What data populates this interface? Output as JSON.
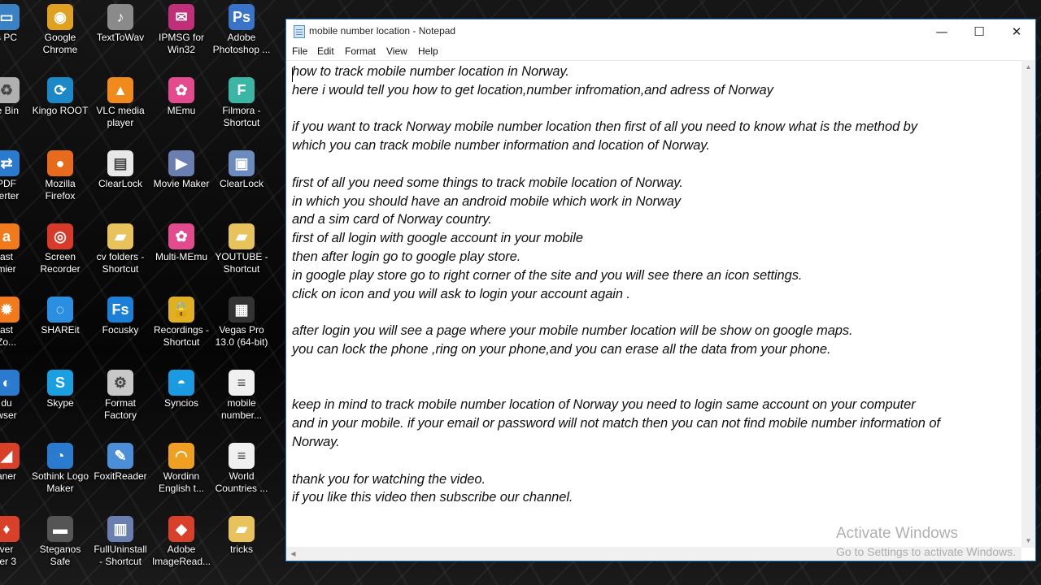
{
  "desktop": {
    "icons": [
      {
        "label": "s PC",
        "icon": "computer-icon",
        "color": "#3b82c4"
      },
      {
        "label": "Google\nChrome",
        "icon": "chrome-icon",
        "color": "#e0a020"
      },
      {
        "label": "TextToWav",
        "icon": "speaker-icon",
        "color": "#8a8a8a"
      },
      {
        "label": "IPMSG for\nWin32",
        "icon": "ipmsg-icon",
        "color": "#c0307a"
      },
      {
        "label": "Adobe\nPhotoshop ...",
        "icon": "photoshop-icon",
        "color": "#3a74c8"
      },
      {
        "label": "le Bin",
        "icon": "recycle-bin-icon",
        "color": "#b0b0b0"
      },
      {
        "label": "Kingo ROOT",
        "icon": "kingo-root-icon",
        "color": "#1b88c8"
      },
      {
        "label": "VLC media\nplayer",
        "icon": "vlc-icon",
        "color": "#f08a1c"
      },
      {
        "label": "MEmu",
        "icon": "memu-icon",
        "color": "#e44b8e"
      },
      {
        "label": "Filmora -\nShortcut",
        "icon": "filmora-icon",
        "color": "#3bb5a4"
      },
      {
        "label": "PDF\nverter",
        "icon": "pdf-converter-icon",
        "color": "#2a7bd0"
      },
      {
        "label": "Mozilla\nFirefox",
        "icon": "firefox-icon",
        "color": "#e86a1c"
      },
      {
        "label": "ClearLock",
        "icon": "clearlock-doc-icon",
        "color": "#e8e8e8"
      },
      {
        "label": "Movie Maker",
        "icon": "movie-maker-icon",
        "color": "#6a7fb0"
      },
      {
        "label": "ClearLock",
        "icon": "clearlock-monitor-icon",
        "color": "#6c8cc0"
      },
      {
        "label": "ast\nmier",
        "icon": "avast-icon",
        "color": "#f07a1c"
      },
      {
        "label": "Screen\nRecorder",
        "icon": "screen-recorder-icon",
        "color": "#d83a2a"
      },
      {
        "label": "cv folders -\nShortcut",
        "icon": "folder-icon",
        "color": "#e8c25a"
      },
      {
        "label": "Multi-MEmu",
        "icon": "multi-memu-icon",
        "color": "#e44b8e"
      },
      {
        "label": "YOUTUBE -\nShortcut",
        "icon": "folder-icon",
        "color": "#e8c25a"
      },
      {
        "label": "ast\nZo...",
        "icon": "gear-icon",
        "color": "#f07a1c"
      },
      {
        "label": "SHAREit",
        "icon": "shareit-icon",
        "color": "#2a8fe0"
      },
      {
        "label": "Focusky",
        "icon": "focusky-icon",
        "color": "#1b7fd8"
      },
      {
        "label": "Recordings -\nShortcut",
        "icon": "lock-icon",
        "color": "#e0b020"
      },
      {
        "label": "Vegas Pro\n13.0 (64-bit)",
        "icon": "vegas-icon",
        "color": "#333"
      },
      {
        "label": "du\nwser",
        "icon": "baidu-browser-icon",
        "color": "#2a7bd0"
      },
      {
        "label": "Skype",
        "icon": "skype-icon",
        "color": "#1aa0e0"
      },
      {
        "label": "Format\nFactory",
        "icon": "format-factory-icon",
        "color": "#c8c8c8"
      },
      {
        "label": "Syncios",
        "icon": "syncios-icon",
        "color": "#1a9ae0"
      },
      {
        "label": "mobile\nnumber...",
        "icon": "text-file-icon",
        "color": "#f0f0f0"
      },
      {
        "label": "aner",
        "icon": "scanner-icon",
        "color": "#d8402a"
      },
      {
        "label": "Sothink Logo\nMaker",
        "icon": "sothink-icon",
        "color": "#2a7bd0"
      },
      {
        "label": "FoxitReader",
        "icon": "foxit-icon",
        "color": "#4a8fd8"
      },
      {
        "label": "Wordinn\nEnglish t...",
        "icon": "wordinn-icon",
        "color": "#f0a020"
      },
      {
        "label": "World\nCountries ...",
        "icon": "text-file-icon",
        "color": "#f0f0f0"
      },
      {
        "label": "ver\nter 3",
        "icon": "driver-icon",
        "color": "#d8402a"
      },
      {
        "label": "Steganos\nSafe",
        "icon": "steganos-icon",
        "color": "#555"
      },
      {
        "label": "FullUninstall\n- Shortcut",
        "icon": "uninstall-icon",
        "color": "#6a7fb0"
      },
      {
        "label": "Adobe\nImageRead...",
        "icon": "imageready-icon",
        "color": "#d8402a"
      },
      {
        "label": "tricks",
        "icon": "folder-icon",
        "color": "#e8c25a"
      }
    ]
  },
  "notepad": {
    "title": "mobile number location - Notepad",
    "menu": [
      "File",
      "Edit",
      "Format",
      "View",
      "Help"
    ],
    "lines": [
      "how to track mobile number location in Norway.",
      "here i would tell you how to get location,number infromation,and adress of Norway",
      "",
      "if you want to track Norway mobile number location then first of all you need to know what is the method by",
      "which you can track mobile number information and location of Norway.",
      "",
      "first of all you need some things to track mobile location of Norway.",
      "in which you should have an android mobile which work in Norway",
      "and a sim card of Norway country.",
      "first of all login with google account in your mobile",
      "then after login go to google play store.",
      "in google play store go to right corner of the site and you will see there an icon settings.",
      "click on icon and you will ask to login your account again .",
      "",
      "after login you will see a page where your mobile number location will be show on google maps.",
      "you can lock the phone ,ring on your phone,and you can erase all the data from your phone.",
      "",
      "",
      "keep in mind to track mobile number location of Norway you need to login same account on your computer",
      "and in your mobile. if your email or password will not match then you can not find mobile number information of",
      "Norway.",
      "",
      "thank you for watching the video.",
      "if you like this video then subscribe our channel."
    ]
  },
  "watermark": {
    "line1": "Activate Windows",
    "line2": "Go to Settings to activate Windows."
  }
}
